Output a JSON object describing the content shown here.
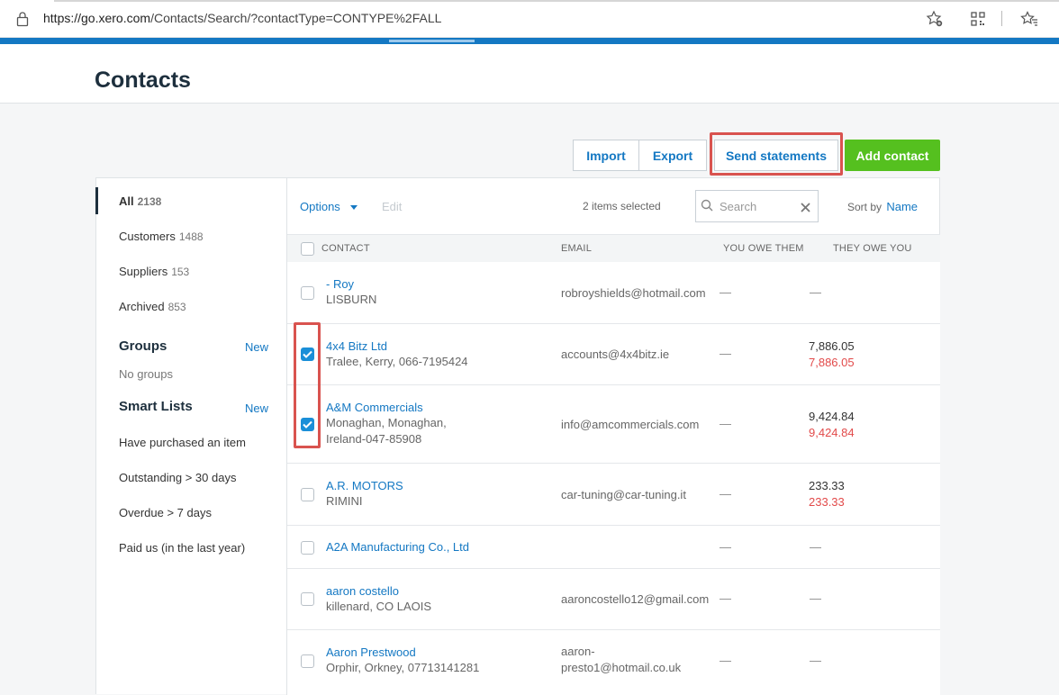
{
  "browser": {
    "url_host": "https://go.xero.com",
    "url_path": "/Contacts/Search/?contactType=CONTYPE%2FALL"
  },
  "page": {
    "title": "Contacts"
  },
  "toolbar": {
    "import_label": "Import",
    "export_label": "Export",
    "send_statements_label": "Send statements",
    "add_contact_label": "Add contact"
  },
  "sidebar": {
    "filters": [
      {
        "label": "All",
        "count": "2138"
      },
      {
        "label": "Customers",
        "count": "1488"
      },
      {
        "label": "Suppliers",
        "count": "153"
      },
      {
        "label": "Archived",
        "count": "853"
      }
    ],
    "groups": {
      "heading": "Groups",
      "new_label": "New",
      "empty_text": "No groups"
    },
    "smart_lists": {
      "heading": "Smart Lists",
      "new_label": "New",
      "items": [
        "Have purchased an item",
        "Outstanding > 30 days",
        "Overdue > 7 days",
        "Paid us (in the last year)"
      ]
    }
  },
  "list_toolbar": {
    "options_label": "Options",
    "edit_label": "Edit",
    "selected_text": "2 items selected",
    "search_placeholder": "Search",
    "sort_prefix": "Sort by",
    "sort_value": "Name"
  },
  "columns": {
    "contact": "CONTACT",
    "email": "EMAIL",
    "you_owe": "YOU OWE THEM",
    "they_owe": "THEY OWE YOU"
  },
  "rows": [
    {
      "name": "- Roy",
      "sub1": "LISBURN",
      "sub2": "",
      "email1": "robroyshields@hotmail.com",
      "email2": "",
      "you_owe": "—",
      "they_owe": "—",
      "they_owe_overdue": "",
      "checked": false
    },
    {
      "name": "4x4 Bitz Ltd",
      "sub1": "Tralee, Kerry, 066-7195424",
      "sub2": "",
      "email1": "accounts@4x4bitz.ie",
      "email2": "",
      "you_owe": "—",
      "they_owe": "7,886.05",
      "they_owe_overdue": "7,886.05",
      "checked": true
    },
    {
      "name": "A&M Commercials",
      "sub1": "Monaghan, Monaghan,",
      "sub2": "Ireland-047-85908",
      "email1": "info@amcommercials.com",
      "email2": "",
      "you_owe": "—",
      "they_owe": "9,424.84",
      "they_owe_overdue": "9,424.84",
      "checked": true
    },
    {
      "name": "A.R. MOTORS",
      "sub1": "RIMINI",
      "sub2": "",
      "email1": "car-tuning@car-tuning.it",
      "email2": "",
      "you_owe": "—",
      "they_owe": "233.33",
      "they_owe_overdue": "233.33",
      "checked": false
    },
    {
      "name": "A2A Manufacturing Co., Ltd",
      "sub1": "",
      "sub2": "",
      "email1": "",
      "email2": "",
      "you_owe": "—",
      "they_owe": "—",
      "they_owe_overdue": "",
      "checked": false
    },
    {
      "name": "aaron costello",
      "sub1": "killenard, CO LAOIS",
      "sub2": "",
      "email1": "aaroncostello12@gmail.com",
      "email2": "",
      "you_owe": "—",
      "they_owe": "—",
      "they_owe_overdue": "",
      "checked": false
    },
    {
      "name": "Aaron Prestwood",
      "sub1": "Orphir, Orkney, 07713141281",
      "sub2": "",
      "email1": "aaron-",
      "email2": "presto1@hotmail.co.uk",
      "you_owe": "—",
      "they_owe": "—",
      "they_owe_overdue": "",
      "checked": false
    }
  ],
  "colors": {
    "accent_blue": "#1478c3",
    "add_green": "#55c01f",
    "overdue_red": "#e24a4a",
    "annotation_red": "#d9534f"
  }
}
